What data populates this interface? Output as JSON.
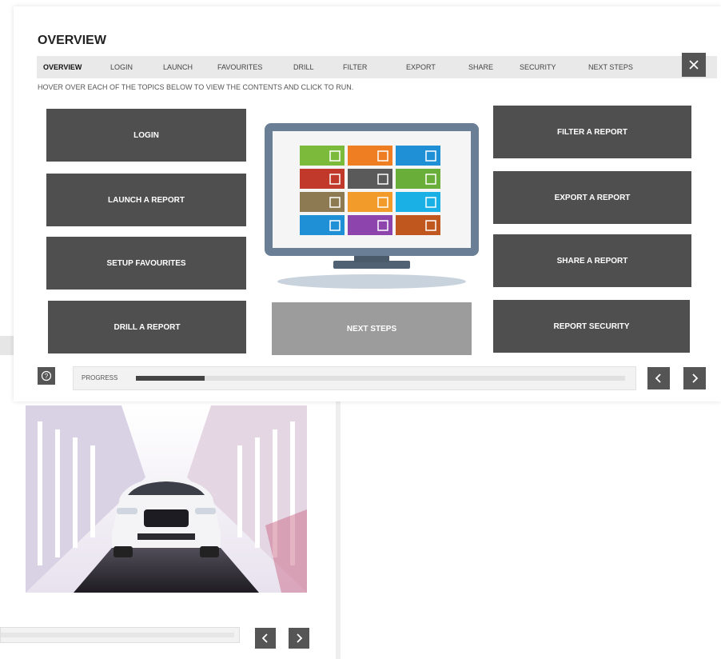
{
  "window": {
    "title": "OVERVIEW",
    "instructions": "HOVER OVER EACH OF THE TOPICS BELOW TO VIEW THE CONTENTS AND CLICK TO RUN."
  },
  "tabs": [
    {
      "label": "OVERVIEW",
      "active": true
    },
    {
      "label": "LOGIN"
    },
    {
      "label": "LAUNCH"
    },
    {
      "label": "FAVOURITES"
    },
    {
      "label": "DRILL"
    },
    {
      "label": "FILTER"
    },
    {
      "label": "EXPORT"
    },
    {
      "label": "SHARE"
    },
    {
      "label": "SECURITY"
    },
    {
      "label": "NEXT STEPS"
    }
  ],
  "topics": {
    "login": "LOGIN",
    "launch": "LAUNCH A REPORT",
    "favourites": "SETUP FAVOURITES",
    "drill": "DRILL A REPORT",
    "next_steps": "NEXT STEPS",
    "filter": "FILTER A REPORT",
    "export": "EXPORT A REPORT",
    "share": "SHARE A REPORT",
    "security": "REPORT SECURITY"
  },
  "monitor_tiles": [
    {
      "color": "#7cba3c"
    },
    {
      "color": "#ef7d22"
    },
    {
      "color": "#1f8fd6"
    },
    {
      "color": "#c0392b"
    },
    {
      "color": "#5a5a5a"
    },
    {
      "color": "#6aae3a"
    },
    {
      "color": "#8d7a52"
    },
    {
      "color": "#f29a2a"
    },
    {
      "color": "#1ab0e6"
    },
    {
      "color": "#1f8fd6"
    },
    {
      "color": "#8e44ad"
    },
    {
      "color": "#c0571e"
    }
  ],
  "progress": {
    "label": "PROGRESS",
    "value": 0.14
  },
  "icons": {
    "close": "close-icon",
    "help": "help-icon",
    "prev": "chevron-left-icon",
    "next": "chevron-right-icon"
  },
  "colors": {
    "button_dark": "#4f4f4f",
    "button_light": "#9c9c9c",
    "tabbar_bg": "#e9e9e9",
    "monitor_frame": "#6a7f95"
  }
}
